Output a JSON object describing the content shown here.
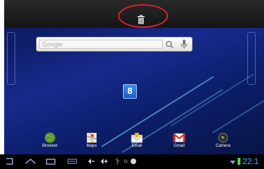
{
  "search": {
    "placeholder": "Google"
  },
  "center_app": {
    "label": "8"
  },
  "dock": [
    {
      "label": "Browser",
      "icon": "browser-globe-icon"
    },
    {
      "label": "Maps",
      "icon": "maps-icon"
    },
    {
      "label": "Email",
      "icon": "email-icon"
    },
    {
      "label": "Gmail",
      "icon": "gmail-icon"
    },
    {
      "label": "Camera",
      "icon": "camera-icon"
    }
  ],
  "status": {
    "time": "22:1"
  },
  "colors": {
    "highlight": "#e0222a",
    "clock": "#36b8ff",
    "battery": "#3ddc4e"
  }
}
